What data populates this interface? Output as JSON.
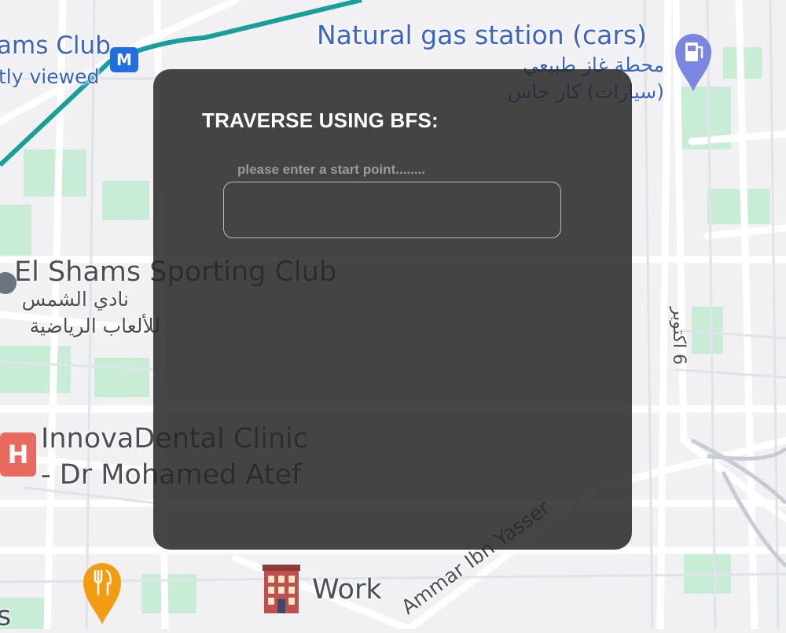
{
  "dialog": {
    "title": "TRAVERSE USING BFS:",
    "start_label": "please enter a start point........",
    "start_input_value": "",
    "start_input_placeholder": ""
  },
  "map": {
    "labels": {
      "shams_club_partial": "ams Club",
      "recently_viewed_partial": "tly viewed",
      "gas_station_en": "Natural gas station (cars)",
      "gas_station_ar_1": "محطة غاز طبيعي",
      "gas_station_ar_2": "(سيارات) كار جاس",
      "sporting_club_en": "El Shams Sporting Club",
      "sporting_club_ar_1": "نادي الشمس",
      "sporting_club_ar_2": "للألعاب الرياضية",
      "dental_1": "InnovaDental Clinic",
      "dental_2": "- Dr Mohamed Atef",
      "street_ammar": "Ammar Ibn Yasser",
      "street_october": "6 اكتوبر",
      "work": "Work",
      "bottom_partial": "s",
      "metro_letter": "M",
      "hospital_letter": "H"
    },
    "colors": {
      "background": "#f1f1f4",
      "road": "#ffffff",
      "park": "#c8ecd6",
      "metro_line": "#16a097",
      "label_blue": "#3a63c4",
      "label_dark": "#4a4f55",
      "pin_purple": "#7b86e0",
      "pin_orange": "#f39c12",
      "hospital_red": "#e86a5e",
      "metro_blue": "#1f6fe0",
      "dialog_bg": "rgba(38,38,38,0.85)"
    },
    "icons": [
      "metro-icon",
      "gas-station-icon",
      "hospital-icon",
      "restaurant-icon",
      "work-building-icon",
      "sports-pin-icon"
    ]
  }
}
